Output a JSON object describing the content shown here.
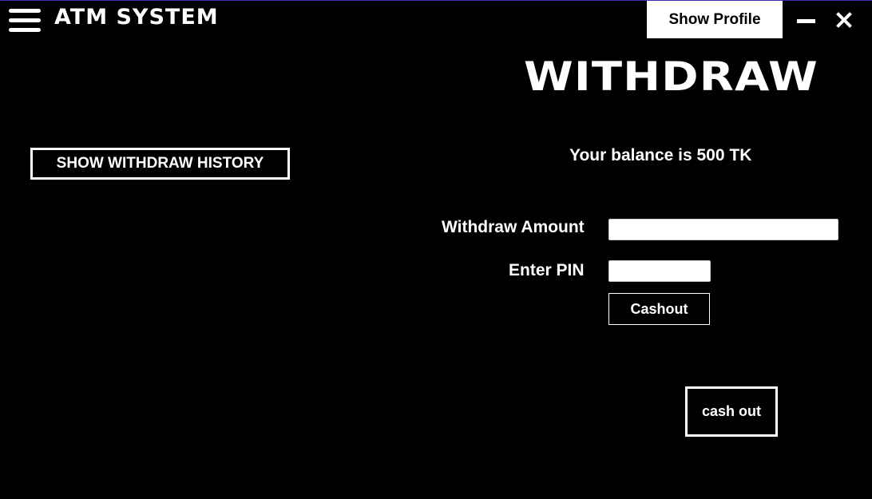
{
  "header": {
    "menu_icon": "hamburger-menu-icon",
    "app_title": "ATM SYSTEM",
    "show_profile_label": "Show Profile",
    "minimize_icon": "minimize-icon",
    "close_icon": "close-icon"
  },
  "main": {
    "heading": "WITHDRAW",
    "history_button_label": "SHOW WITHDRAW HISTORY",
    "balance_text": "Your balance is 500 TK",
    "form": {
      "amount_label": "Withdraw Amount",
      "amount_value": "",
      "pin_label": "Enter PIN",
      "pin_value": "",
      "submit_label": "Cashout"
    },
    "cash_out_label": "cash out"
  },
  "colors": {
    "background": "#000000",
    "foreground": "#ffffff",
    "window_border": "#3a2fb0"
  }
}
